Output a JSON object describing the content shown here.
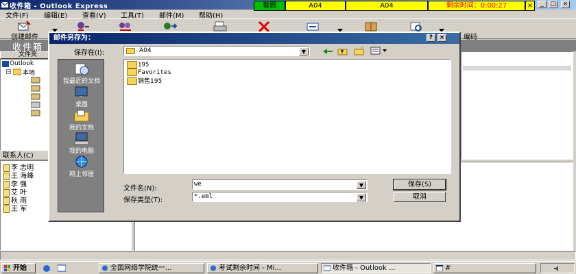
{
  "window": {
    "title": "收件箱 - Outlook Express",
    "controls": {
      "minimize": "_",
      "maximize": "□",
      "close": "×"
    }
  },
  "exam_bar": {
    "status": "看题",
    "field1": "A04",
    "field2": "A04",
    "timer_label": "剩余时间：0:00:27",
    "close": "×"
  },
  "menu": {
    "items": [
      "文件(F)",
      "编辑(E)",
      "查看(V)",
      "工具(T)",
      "邮件(M)",
      "帮助(H)"
    ]
  },
  "toolbar": {
    "create_mail": "创建邮件",
    "decode": "编码"
  },
  "folder_header": {
    "title": "收件箱",
    "folders_tab": "文件夹"
  },
  "tree": {
    "root": "Outlook",
    "local": "本地"
  },
  "contacts": {
    "header": "联系人(C)",
    "items": [
      "李 志明",
      "王 海峰",
      "李 强",
      "艾 叶",
      "秋 雨",
      "王 军"
    ]
  },
  "dialog": {
    "title": "邮件另存为：",
    "help": "?",
    "close": "×",
    "save_in_label": "保存在(I):",
    "save_in_value": "A04",
    "places": [
      "我最近的文档",
      "桌面",
      "我的文档",
      "我的电脑",
      "网上邻居"
    ],
    "files": [
      "195",
      "Favorites",
      "销售195"
    ],
    "filename_label": "文件名(N):",
    "filename_value": "we",
    "filetype_label": "保存类型(T):",
    "filetype_value": "*.eml",
    "save_button": "保存(S)",
    "cancel_button": "取消"
  },
  "taskbar": {
    "start": "开始",
    "tasks": [
      "全国网络学院统一...",
      "考试剩余时间 - Mi...",
      "收件箱 - Outlook ...",
      "#"
    ]
  },
  "colors": {
    "title_active": "#0a246a",
    "exam_timer_bg": "#ffff00",
    "exam_timer_fg": "#ff0000",
    "exam_status_bg": "#00c000"
  }
}
